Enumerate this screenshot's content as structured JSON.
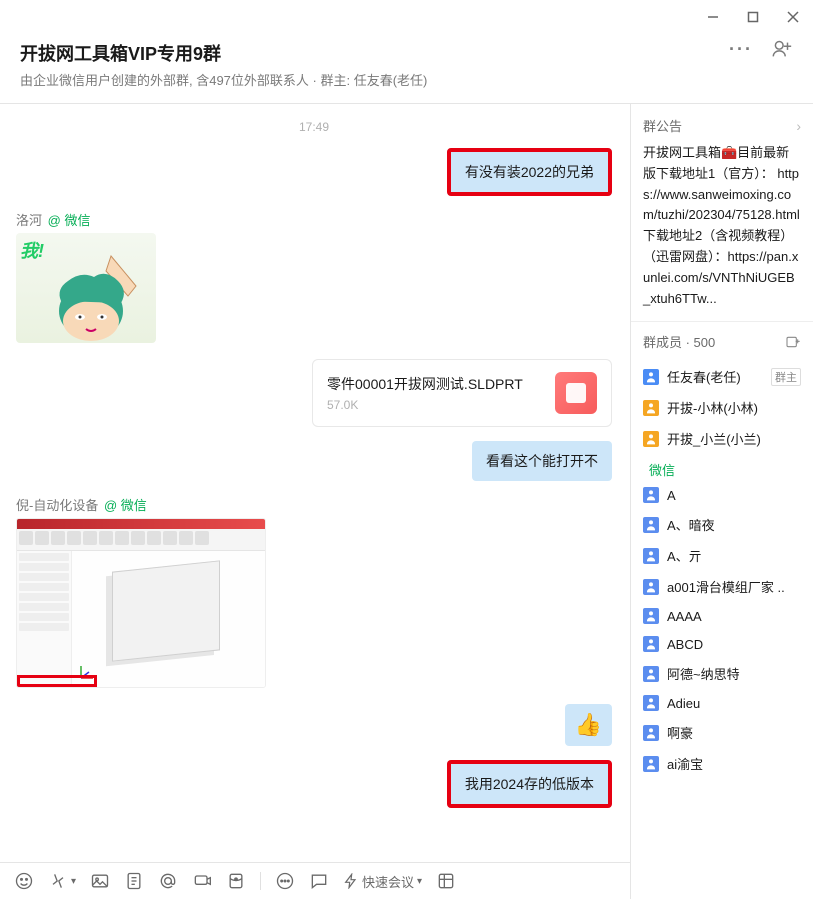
{
  "header": {
    "title": "开拔网工具箱VIP专用9群",
    "subtitle": "由企业微信用户创建的外部群, 含497位外部联系人 · 群主: 任友春(老任)"
  },
  "chat": {
    "timestamp": "17:49",
    "msg1": "有没有装2022的兄弟",
    "sender1_name": "洛河",
    "sender1_via": "@ 微信",
    "sticker_text": "我!",
    "file_name": "零件00001开拔网测试.SLDPRT",
    "file_size": "57.0K",
    "msg2": "看看这个能打开不",
    "sender2_name": "倪-自动化设备",
    "sender2_via": "@ 微信",
    "thumb_emoji": "👍",
    "msg3": "我用2024存的低版本"
  },
  "toolbar": {
    "quick_meeting": "快速会议"
  },
  "sidebar": {
    "notice_title": "群公告",
    "notice_body": "开拔网工具箱🧰目前最新版下载地址1（官方）： https://www.sanweimoxing.com/tuzhi/202304/75128.html 下载地址2（含视频教程）（迅雷网盘）：https://pan.xunlei.com/s/VNThNiUGEB_xtuh6TTw...",
    "members_title": "群成员 · 500",
    "owner_badge": "群主",
    "members_org": [
      {
        "name": "任友春(老任)",
        "owner": true
      },
      {
        "name": "开拔-小林(小林)",
        "owner": false
      },
      {
        "name": "开拔_小兰(小兰)",
        "owner": false
      }
    ],
    "wechat_label": "微信",
    "members_ext": [
      "A",
      "A、暗夜",
      "A、亓",
      "a001滑台模组厂家 ..",
      "AAAA",
      "ABCD",
      "阿德~纳思特",
      "Adieu",
      "啊豪",
      "ai渝宝"
    ]
  }
}
